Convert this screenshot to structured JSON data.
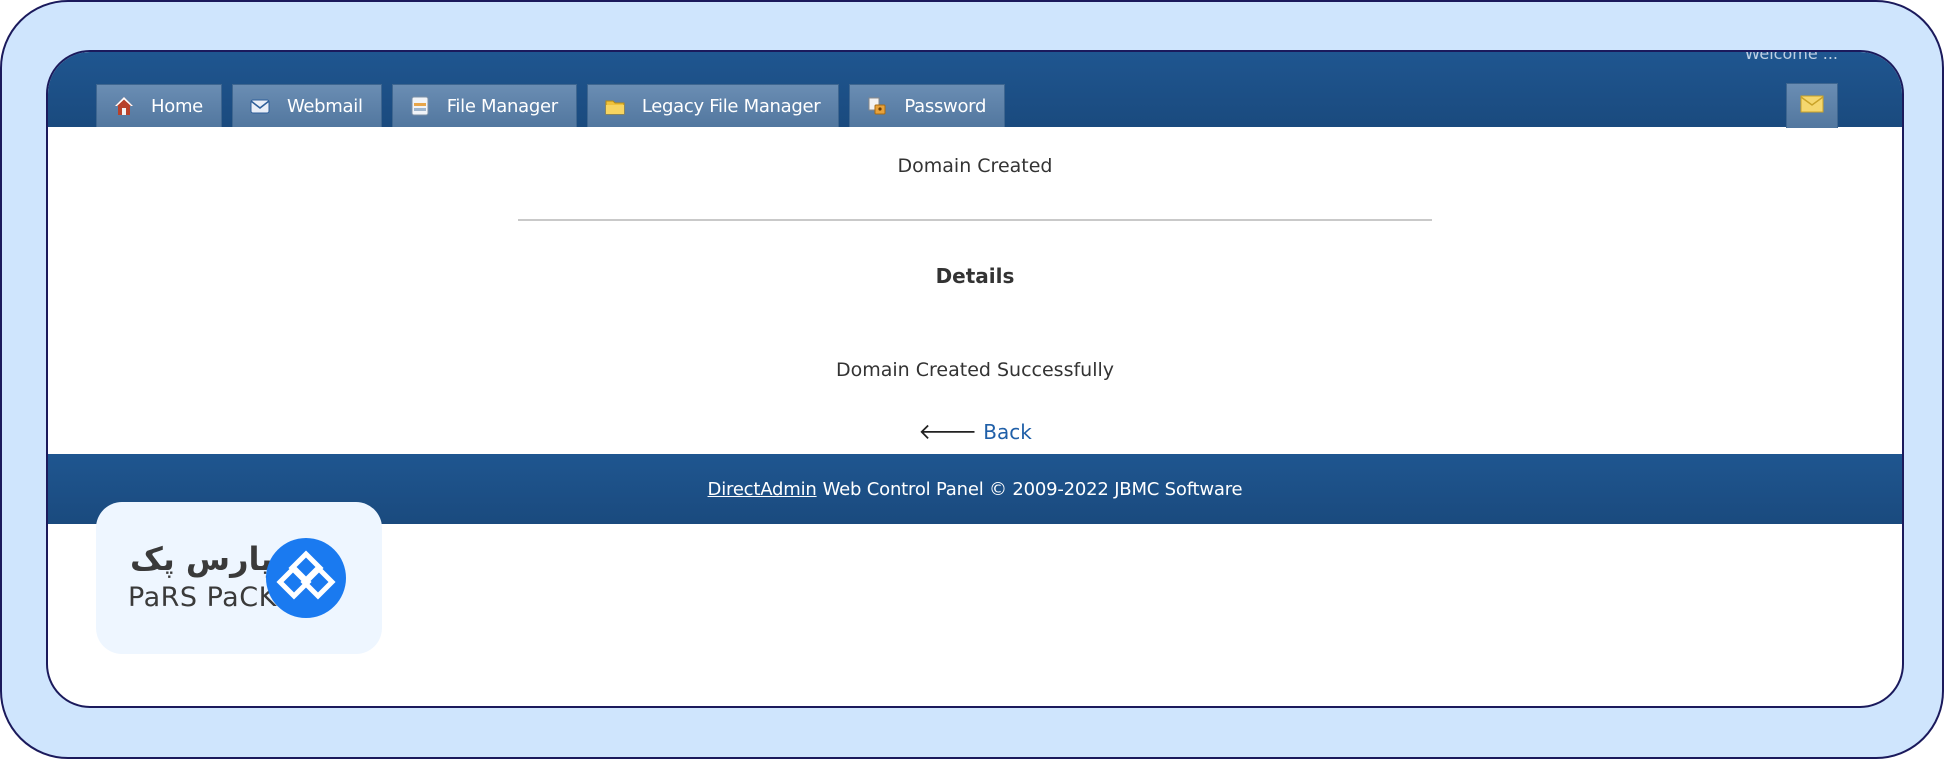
{
  "header": {
    "welcome_text": "Welcome ...",
    "tabs": [
      {
        "label": "Home",
        "icon": "home-icon"
      },
      {
        "label": "Webmail",
        "icon": "envelope-icon"
      },
      {
        "label": "File Manager",
        "icon": "file-cabinet-icon"
      },
      {
        "label": "Legacy File Manager",
        "icon": "folder-icon"
      },
      {
        "label": "Password",
        "icon": "key-lock-icon"
      }
    ],
    "mail_icon": "mail-icon"
  },
  "main": {
    "status_title": "Domain Created",
    "details_heading": "Details",
    "detail_message": "Domain Created Successfully",
    "back_label": "Back",
    "back_icon": "arrow-left-icon"
  },
  "footer": {
    "brand_link": "DirectAdmin",
    "text": "Web Control Panel © 2009-2022 JBMC Software"
  },
  "logo": {
    "name_fa": "پارس پک",
    "name_en": "PaRS PaCK",
    "brand_color": "#1a7af0"
  },
  "colors": {
    "frame_bg": "#cfe5fd",
    "frame_border": "#1b1a5c",
    "nav_bg": "#1f5690",
    "tab_bg": "#6a8db3",
    "link": "#1f5fa8"
  }
}
